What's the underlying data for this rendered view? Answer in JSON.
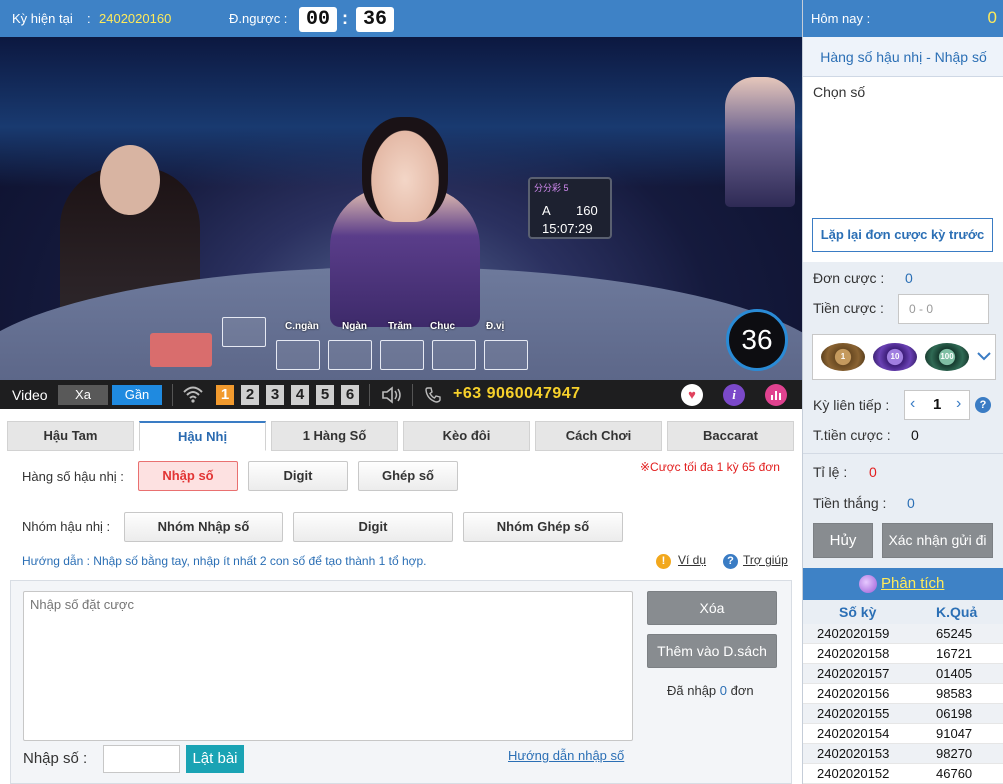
{
  "header": {
    "period_label": "Kỳ hiện tại",
    "colon": ":",
    "period_value": "2402020160",
    "countdown_label": "Đ.ngược :",
    "countdown_min": "00",
    "countdown_sep": ":",
    "countdown_sec": "36"
  },
  "video": {
    "screen_brand": "分分彩 5",
    "screen_row1_label": "A",
    "screen_row1_value": "160",
    "screen_time": "15:07:29",
    "timer": "36",
    "card_labels": [
      "C.ngàn",
      "Ngàn",
      "Trăm",
      "Chục",
      "Đ.vị"
    ],
    "bar": {
      "label": "Video",
      "far": "Xa",
      "near": "Gần",
      "cameras": [
        "1",
        "2",
        "3",
        "4",
        "5",
        "6"
      ],
      "active_camera": "1",
      "phone": "+63 9060047947",
      "colors": {
        "far_bg": "#595959",
        "near_bg": "#1f8ae0",
        "active_cam": "#f29a2e"
      }
    }
  },
  "tabs": [
    {
      "label": "Hậu Tam",
      "active": false
    },
    {
      "label": "Hậu Nhị",
      "active": true
    },
    {
      "label": "1 Hàng Số",
      "active": false
    },
    {
      "label": "Kèo đôi",
      "active": false
    },
    {
      "label": "Cách Chơi",
      "active": false
    },
    {
      "label": "Baccarat",
      "active": false
    }
  ],
  "bet_options": {
    "row1_label": "Hàng số hậu nhị :",
    "row1_buttons": [
      "Nhập số",
      "Digit",
      "Ghép số"
    ],
    "row1_selected": "Nhập số",
    "max_note": "※Cược tối đa 1 kỳ 65 đơn",
    "row2_label": "Nhóm hậu nhị :",
    "row2_buttons": [
      "Nhóm Nhập số",
      "Digit",
      "Nhóm Ghép số"
    ],
    "guide": "Hướng dẫn : Nhập số bằng tay, nhập ít nhất 2 con số để tạo thành 1 tổ hợp.",
    "example_link": "Ví dụ",
    "help_link": "Trợ giúp"
  },
  "entry": {
    "placeholder": "Nhập số đặt cược",
    "clear_button": "Xóa",
    "add_button": "Thêm vào D.sách",
    "count_prefix": "Đã nhập",
    "count_value": "0",
    "count_suffix": "đơn",
    "input_label": "Nhập số :",
    "flip_button": "Lật bài",
    "guide_link": "Hướng dẫn nhập số"
  },
  "right": {
    "today_label": "Hôm nay :",
    "today_value": "0",
    "subtitle": "Hàng số hậu nhị - Nhập số",
    "pick_title": "Chọn số",
    "repeat_button": "Lặp lại đơn cược kỳ trước",
    "orders_label": "Đơn cược :",
    "orders_value": "0",
    "amount_label": "Tiền cược :",
    "amount_placeholder": "0 - 0",
    "chips": [
      "1",
      "10",
      "100"
    ],
    "consecutive_label": "Kỳ liên tiếp :",
    "consecutive_value": "1",
    "total_label": "T.tiền cược :",
    "total_value": "0",
    "ratio_label": "Tỉ lệ :",
    "ratio_value": "0",
    "win_label": "Tiền thắng :",
    "win_value": "0",
    "cancel_button": "Hủy",
    "confirm_button": "Xác nhận gửi đi",
    "analysis_link": "Phân tích",
    "history": {
      "col_period": "Số kỳ",
      "col_result": "K.Quả",
      "rows": [
        [
          "2402020159",
          "65245"
        ],
        [
          "2402020158",
          "16721"
        ],
        [
          "2402020157",
          "01405"
        ],
        [
          "2402020156",
          "98583"
        ],
        [
          "2402020155",
          "06198"
        ],
        [
          "2402020154",
          "91047"
        ],
        [
          "2402020153",
          "98270"
        ],
        [
          "2402020152",
          "46760"
        ]
      ]
    }
  }
}
